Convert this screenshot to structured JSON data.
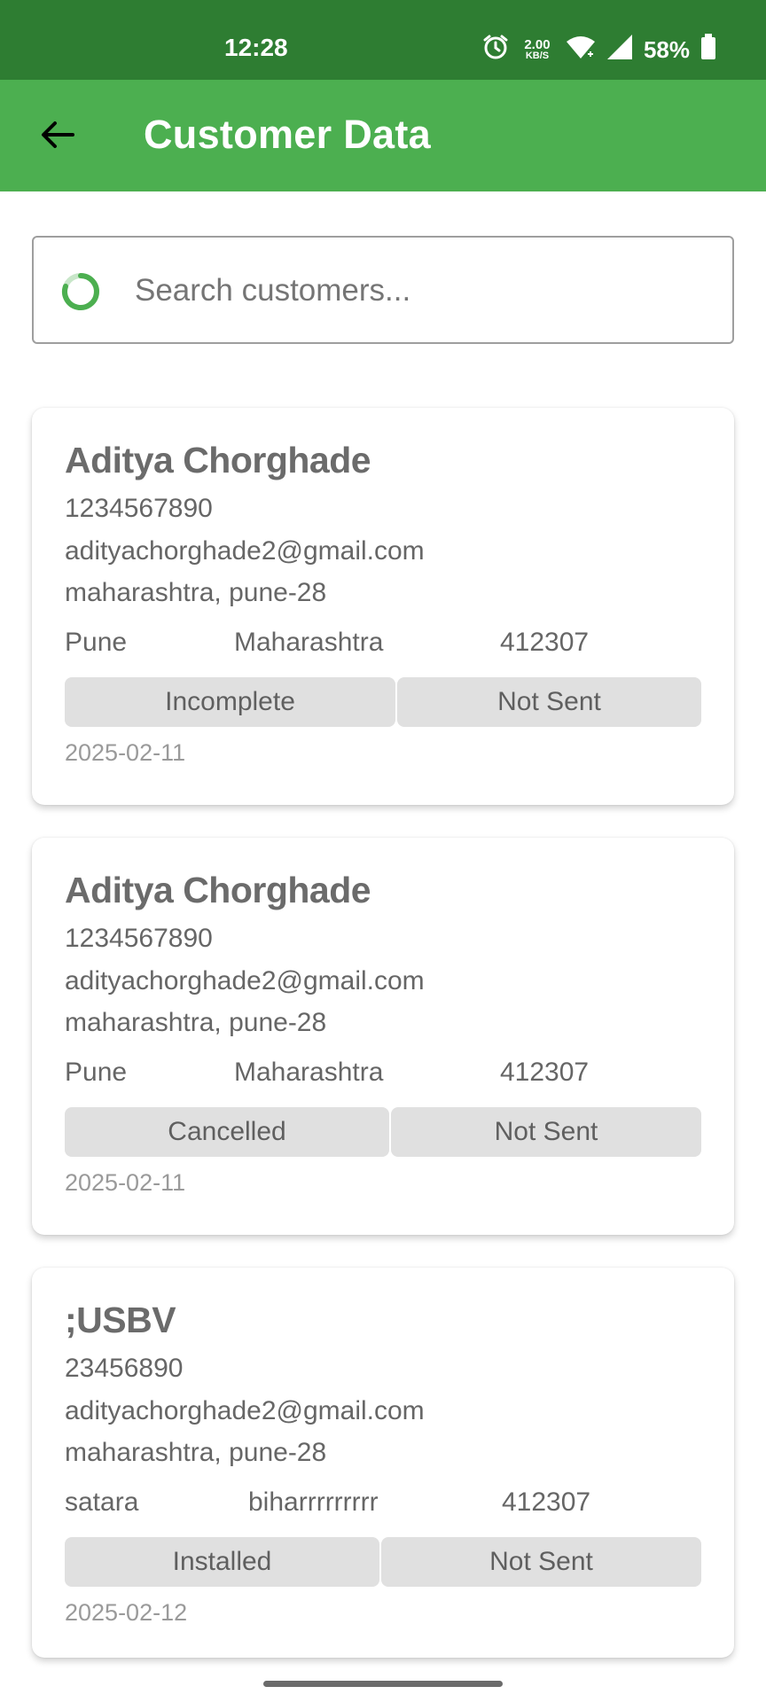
{
  "status_bar": {
    "time": "12:28",
    "net_speed_value": "2.00",
    "net_speed_unit": "KB/S",
    "battery": "58%"
  },
  "app_bar": {
    "title": "Customer Data",
    "back_icon": "arrow-left-icon"
  },
  "search": {
    "placeholder": "Search customers...",
    "value": "",
    "icon": "loading-spinner-icon",
    "accent_color": "#4caf50"
  },
  "theme": {
    "status_bar_color": "#2e7d32",
    "app_bar_color": "#4caf50"
  },
  "customers": [
    {
      "name": "Aditya Chorghade",
      "phone": "1234567890",
      "email": "adityachorghade2@gmail.com",
      "address": "maharashtra, pune-28",
      "city": "Pune",
      "state": "Maharashtra",
      "pincode": "412307",
      "status": "Incomplete",
      "sent_status": "Not Sent",
      "date": "2025-02-11"
    },
    {
      "name": "Aditya Chorghade",
      "phone": "1234567890",
      "email": "adityachorghade2@gmail.com",
      "address": "maharashtra, pune-28",
      "city": "Pune",
      "state": "Maharashtra",
      "pincode": "412307",
      "status": "Cancelled",
      "sent_status": "Not Sent",
      "date": "2025-02-11"
    },
    {
      "name": ";USBV",
      "phone": "23456890",
      "email": "adityachorghade2@gmail.com",
      "address": "maharashtra, pune-28",
      "city": "satara",
      "state": "biharrrrrrrrr",
      "pincode": "412307",
      "status": "Installed",
      "sent_status": "Not Sent",
      "date": "2025-02-12"
    }
  ]
}
